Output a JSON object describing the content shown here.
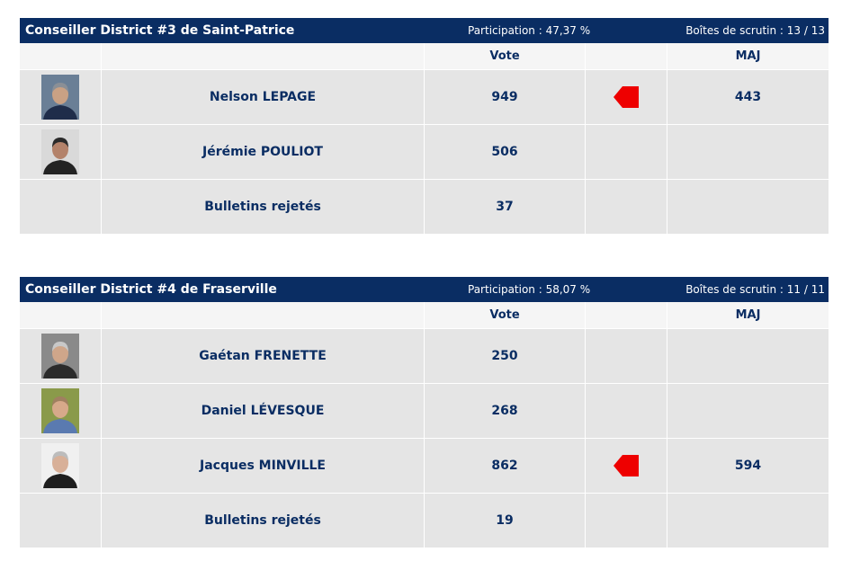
{
  "races": [
    {
      "title": "Conseiller District #3 de Saint-Patrice",
      "participation": "Participation : 47,37 %",
      "boxes": "Boîtes de scrutin : 13 / 13",
      "col_vote": "Vote",
      "col_maj": "MAJ",
      "rows": [
        {
          "name": "Nelson LEPAGE",
          "vote": "949",
          "maj": "443",
          "leader": true,
          "photo": {
            "bg": "#6a7f96",
            "skin": "#c9a184",
            "shirt": "#1f2d4a",
            "hair": "#8a8f96"
          }
        },
        {
          "name": "Jérémie POULIOT",
          "vote": "506",
          "maj": "",
          "leader": false,
          "photo": {
            "bg": "#d9d9d9",
            "skin": "#b3826a",
            "shirt": "#232323",
            "hair": "#2a2a2a"
          }
        },
        {
          "name": "Bulletins rejetés",
          "vote": "37",
          "maj": "",
          "leader": false,
          "photo": null
        }
      ]
    },
    {
      "title": "Conseiller District #4 de Fraserville",
      "participation": "Participation : 58,07 %",
      "boxes": "Boîtes de scrutin : 11 / 11",
      "col_vote": "Vote",
      "col_maj": "MAJ",
      "rows": [
        {
          "name": "Gaétan FRENETTE",
          "vote": "250",
          "maj": "",
          "leader": false,
          "photo": {
            "bg": "#8a8a8a",
            "skin": "#cfa68a",
            "shirt": "#2b2b2b",
            "hair": "#c8c8c8"
          }
        },
        {
          "name": "Daniel LÉVESQUE",
          "vote": "268",
          "maj": "",
          "leader": false,
          "photo": {
            "bg": "#8a9a4a",
            "skin": "#d7a98a",
            "shirt": "#5a7ab0",
            "hair": "#a08060"
          }
        },
        {
          "name": "Jacques MINVILLE",
          "vote": "862",
          "maj": "594",
          "leader": true,
          "photo": {
            "bg": "#f0f0f0",
            "skin": "#d8b098",
            "shirt": "#1e1e1e",
            "hair": "#bcbcbc"
          }
        },
        {
          "name": "Bulletins rejetés",
          "vote": "19",
          "maj": "",
          "leader": false,
          "photo": null
        }
      ]
    }
  ],
  "colors": {
    "header_bg": "#0a2d63",
    "row_bg": "#e5e5e5",
    "col_head_bg": "#f5f5f5",
    "text": "#0a2d63",
    "leader_flag": "#ee0000"
  }
}
